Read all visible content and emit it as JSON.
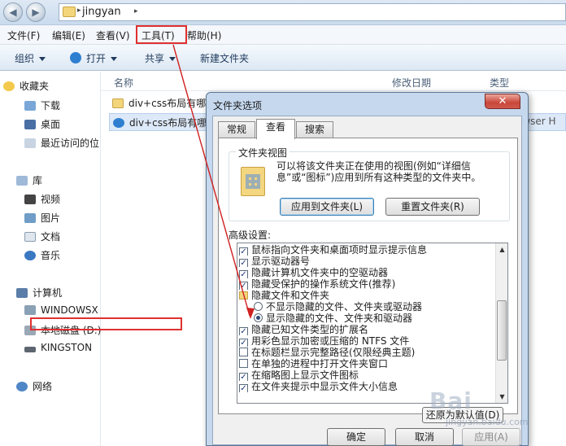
{
  "window": {
    "address_path": "jingyan",
    "back_icon": "back-arrow-icon",
    "forward_icon": "forward-arrow-icon"
  },
  "menubar": {
    "items": [
      {
        "label": "文件(F)"
      },
      {
        "label": "编辑(E)"
      },
      {
        "label": "查看(V)"
      },
      {
        "label": "工具(T)"
      },
      {
        "label": "帮助(H)"
      }
    ]
  },
  "toolbar": {
    "organize": "组织",
    "open": "打开",
    "share": "共享",
    "new_folder": "新建文件夹"
  },
  "sidebar": {
    "favorites": "收藏夹",
    "downloads": "下载",
    "desktop": "桌面",
    "recent": "最近访问的位",
    "libraries": "库",
    "videos": "视频",
    "pictures": "图片",
    "documents": "文档",
    "music": "音乐",
    "computer": "计算机",
    "drive_windows": "WINDOWSX",
    "drive_local": "本地磁盘 (D:)",
    "drive_kingston": "KINGSTON",
    "network": "网络"
  },
  "content": {
    "columns": {
      "name": "名称",
      "modified": "修改日期",
      "type": "类型"
    },
    "files": [
      {
        "name": "div+css布局有哪"
      },
      {
        "name": "div+css布局有哪"
      }
    ],
    "type_cell": "owser H"
  },
  "dialog": {
    "title": "文件夹选项",
    "close_label": "✕",
    "tabs": [
      {
        "label": "常规"
      },
      {
        "label": "查看"
      },
      {
        "label": "搜索"
      }
    ],
    "folder_views_label": "文件夹视图",
    "folder_views_desc": "可以将该文件夹正在使用的视图(例如“详细信息”或“图标”)应用到所有这种类型的文件夹中。",
    "apply_to_folders": "应用到文件夹(L)",
    "reset_folders": "重置文件夹(R)",
    "advanced_label": "高级设置:",
    "advanced_rows": [
      {
        "text": "鼠标指向文件夹和桌面项时显示提示信息",
        "kind": "checkbox",
        "checked": true
      },
      {
        "text": "显示驱动器号",
        "kind": "checkbox",
        "checked": true
      },
      {
        "text": "隐藏计算机文件夹中的空驱动器",
        "kind": "checkbox",
        "checked": true
      },
      {
        "text": "隐藏受保护的操作系统文件(推荐)",
        "kind": "checkbox",
        "checked": true
      },
      {
        "text": "隐藏文件和文件夹",
        "kind": "folder",
        "checked": false
      },
      {
        "text": "不显示隐藏的文件、文件夹或驱动器",
        "kind": "radio",
        "checked": false
      },
      {
        "text": "显示隐藏的文件、文件夹和驱动器",
        "kind": "radio",
        "checked": true
      },
      {
        "text": "隐藏已知文件类型的扩展名",
        "kind": "checkbox",
        "checked": true
      },
      {
        "text": "用彩色显示加密或压缩的 NTFS 文件",
        "kind": "checkbox",
        "checked": true
      },
      {
        "text": "在标题栏显示完整路径(仅限经典主题)",
        "kind": "checkbox",
        "checked": false
      },
      {
        "text": "在单独的进程中打开文件夹窗口",
        "kind": "checkbox",
        "checked": false
      },
      {
        "text": "在缩略图上显示文件图标",
        "kind": "checkbox",
        "checked": true
      },
      {
        "text": "在文件夹提示中显示文件大小信息",
        "kind": "checkbox",
        "checked": true
      }
    ],
    "restore_defaults": "还原为默认值(D)",
    "ok": "确定",
    "cancel": "取消",
    "apply": "应用(A)"
  },
  "watermark": {
    "text": "Bai",
    "subtext": "jingyan.baidu.com"
  },
  "colors": {
    "highlight_red": "#e03030",
    "dialog_frame": "#c5d8ee",
    "selection": "#dde9f8"
  }
}
